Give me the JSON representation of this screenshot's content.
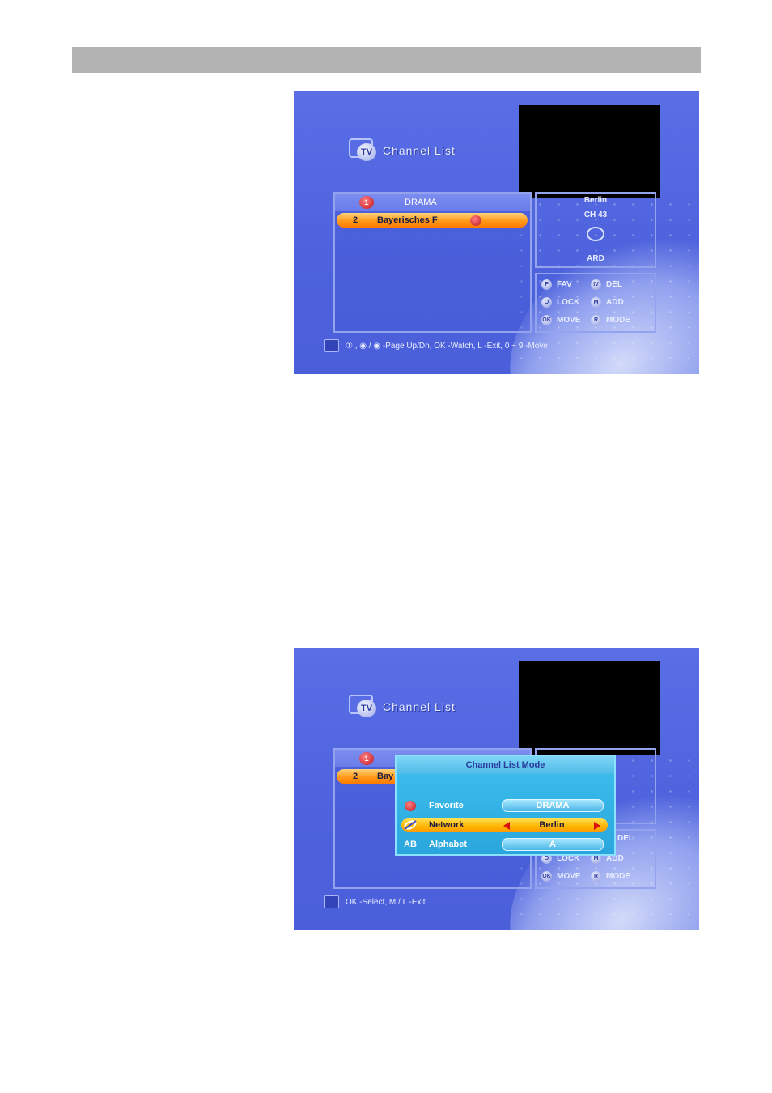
{
  "screen1": {
    "title": "Channel List",
    "tv_icon_label": "TV",
    "list": {
      "group_number": "1",
      "group_name": "DRAMA",
      "rows": [
        {
          "number": "2",
          "name": "Bayerisches F"
        }
      ]
    },
    "info": {
      "location": "Berlin",
      "channel": "CH 43",
      "provider": "ARD"
    },
    "keys": [
      {
        "key": "F",
        "label": "FAV"
      },
      {
        "key": "IV",
        "label": "DEL"
      },
      {
        "key": "O",
        "label": "LOCK"
      },
      {
        "key": "M",
        "label": "ADD"
      },
      {
        "key": "OK",
        "label": "MOVE"
      },
      {
        "key": "R",
        "label": "MODE"
      }
    ],
    "help": "① , ◉ / ◉ -Page Up/Dn, OK -Watch, L -Exit, 0 ~ 9 -Move"
  },
  "screen2": {
    "title": "Channel List",
    "tv_icon_label": "TV",
    "list": {
      "group_number": "1",
      "rows": [
        {
          "number": "2",
          "name": "Bay"
        }
      ]
    },
    "keys_partial": [
      {
        "key": "",
        "label": "DEL"
      },
      {
        "key": "O",
        "label": "LOCK"
      },
      {
        "key": "M",
        "label": "ADD"
      },
      {
        "key": "OK",
        "label": "MOVE"
      },
      {
        "key": "R",
        "label": "MODE"
      }
    ],
    "popup": {
      "title": "Channel List Mode",
      "rows": [
        {
          "label": "Favorite",
          "value": "DRAMA",
          "icon": "apple-icon"
        },
        {
          "label": "Network",
          "value": "Berlin",
          "icon": "satellite-icon",
          "selected": true
        },
        {
          "label": "Alphabet",
          "value": "A",
          "icon": "ab-icon",
          "icon_text": "AB"
        }
      ]
    },
    "help": "OK -Select, M / L -Exit"
  },
  "colors": {
    "screen_blue": "#4d62dc",
    "highlight_orange": "#ff9a1a",
    "popup_cyan": "#2aa6dd",
    "header_gray": "#b3b3b3"
  }
}
